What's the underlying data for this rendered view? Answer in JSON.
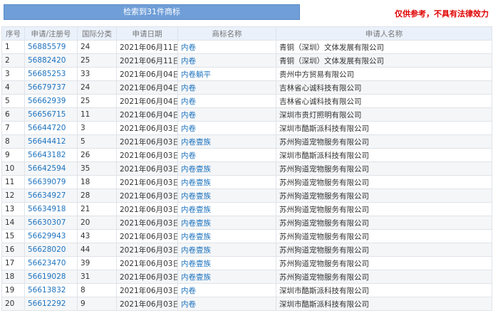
{
  "banner": "检索到31件商标",
  "disclaimer": "仅供参考，不具有法律效力",
  "columns": [
    "序号",
    "申请/注册号",
    "国际分类",
    "申请日期",
    "商标名称",
    "申请人名称"
  ],
  "rows": [
    {
      "no": "1",
      "reg": "56885579",
      "cls": "24",
      "date": "2021年06月11日",
      "mark": "内卷",
      "applicant": "青铜（深圳）文体发展有限公司"
    },
    {
      "no": "2",
      "reg": "56882420",
      "cls": "25",
      "date": "2021年06月11日",
      "mark": "内卷",
      "applicant": "青铜（深圳）文体发展有限公司"
    },
    {
      "no": "3",
      "reg": "56685253",
      "cls": "33",
      "date": "2021年06月04日",
      "mark": "内卷躺平",
      "applicant": "贵州中方贸易有限公司"
    },
    {
      "no": "4",
      "reg": "56679737",
      "cls": "24",
      "date": "2021年06月04日",
      "mark": "内卷",
      "applicant": "吉林省心诚科技有限公司"
    },
    {
      "no": "5",
      "reg": "56662939",
      "cls": "25",
      "date": "2021年06月04日",
      "mark": "内卷",
      "applicant": "吉林省心诚科技有限公司"
    },
    {
      "no": "6",
      "reg": "56656715",
      "cls": "11",
      "date": "2021年06月04日",
      "mark": "内卷",
      "applicant": "深圳市贵灯照明有限公司"
    },
    {
      "no": "7",
      "reg": "56644720",
      "cls": "3",
      "date": "2021年06月03日",
      "mark": "内卷",
      "applicant": "深圳市酷斯派科技有限公司"
    },
    {
      "no": "8",
      "reg": "56644412",
      "cls": "5",
      "date": "2021年06月03日",
      "mark": "内卷壹族",
      "applicant": "苏州狗道宠物服务有限公司"
    },
    {
      "no": "9",
      "reg": "56643182",
      "cls": "26",
      "date": "2021年06月03日",
      "mark": "内卷",
      "applicant": "深圳市酷斯派科技有限公司"
    },
    {
      "no": "10",
      "reg": "56642594",
      "cls": "35",
      "date": "2021年06月03日",
      "mark": "内卷壹族",
      "applicant": "苏州狗道宠物服务有限公司"
    },
    {
      "no": "11",
      "reg": "56639079",
      "cls": "18",
      "date": "2021年06月03日",
      "mark": "内卷壹族",
      "applicant": "苏州狗道宠物服务有限公司"
    },
    {
      "no": "12",
      "reg": "56634927",
      "cls": "28",
      "date": "2021年06月03日",
      "mark": "内卷壹族",
      "applicant": "苏州狗道宠物服务有限公司"
    },
    {
      "no": "13",
      "reg": "56634918",
      "cls": "21",
      "date": "2021年06月03日",
      "mark": "内卷壹族",
      "applicant": "苏州狗道宠物服务有限公司"
    },
    {
      "no": "14",
      "reg": "56630307",
      "cls": "20",
      "date": "2021年06月03日",
      "mark": "内卷壹族",
      "applicant": "苏州狗道宠物服务有限公司"
    },
    {
      "no": "15",
      "reg": "56629943",
      "cls": "43",
      "date": "2021年06月03日",
      "mark": "内卷壹族",
      "applicant": "苏州狗道宠物服务有限公司"
    },
    {
      "no": "16",
      "reg": "56628020",
      "cls": "44",
      "date": "2021年06月03日",
      "mark": "内卷壹族",
      "applicant": "苏州狗道宠物服务有限公司"
    },
    {
      "no": "17",
      "reg": "56623470",
      "cls": "39",
      "date": "2021年06月03日",
      "mark": "内卷壹族",
      "applicant": "苏州狗道宠物服务有限公司"
    },
    {
      "no": "18",
      "reg": "56619028",
      "cls": "31",
      "date": "2021年06月03日",
      "mark": "内卷壹族",
      "applicant": "苏州狗道宠物服务有限公司"
    },
    {
      "no": "19",
      "reg": "56613832",
      "cls": "8",
      "date": "2021年06月03日",
      "mark": "内卷",
      "applicant": "深圳市酷斯派科技有限公司"
    },
    {
      "no": "20",
      "reg": "56612292",
      "cls": "9",
      "date": "2021年06月03日",
      "mark": "内卷",
      "applicant": "深圳市酷斯派科技有限公司"
    }
  ]
}
